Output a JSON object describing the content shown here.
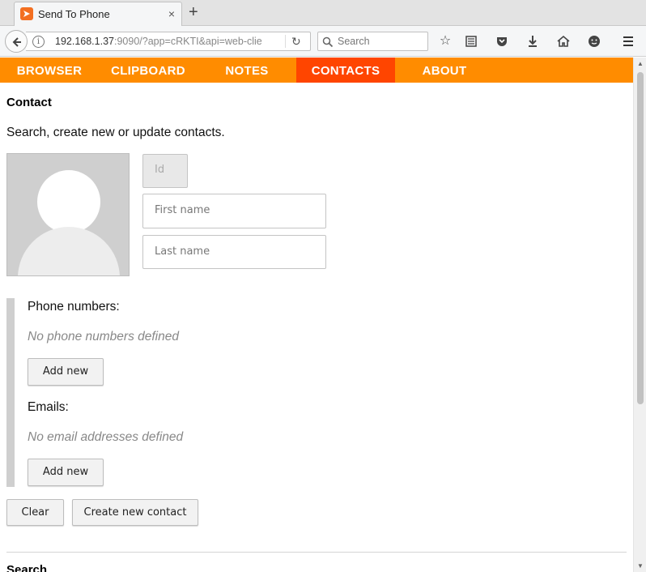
{
  "browser": {
    "tab_title": "Send To Phone",
    "tab_close": "×",
    "new_tab": "+",
    "url_host": "192.168.1.37",
    "url_rest": ":9090/?app=cRKTI&api=web-clie",
    "search_placeholder": "Search"
  },
  "app_nav": {
    "items": [
      "BROWSER",
      "CLIPBOARD",
      "NOTES",
      "CONTACTS",
      "ABOUT"
    ],
    "active": "CONTACTS"
  },
  "contact": {
    "heading": "Contact",
    "intro": "Search, create new or update contacts.",
    "id_placeholder": "Id",
    "first_name_placeholder": "First name",
    "last_name_placeholder": "Last name",
    "phone_label": "Phone numbers:",
    "phone_empty": "No phone numbers defined",
    "phone_add": "Add new",
    "email_label": "Emails:",
    "email_empty": "No email addresses defined",
    "email_add": "Add new",
    "clear_button": "Clear",
    "create_button": "Create new contact"
  },
  "search": {
    "heading": "Search"
  },
  "colors": {
    "nav_bg": "#ff8c00",
    "nav_active": "#ff4500"
  }
}
